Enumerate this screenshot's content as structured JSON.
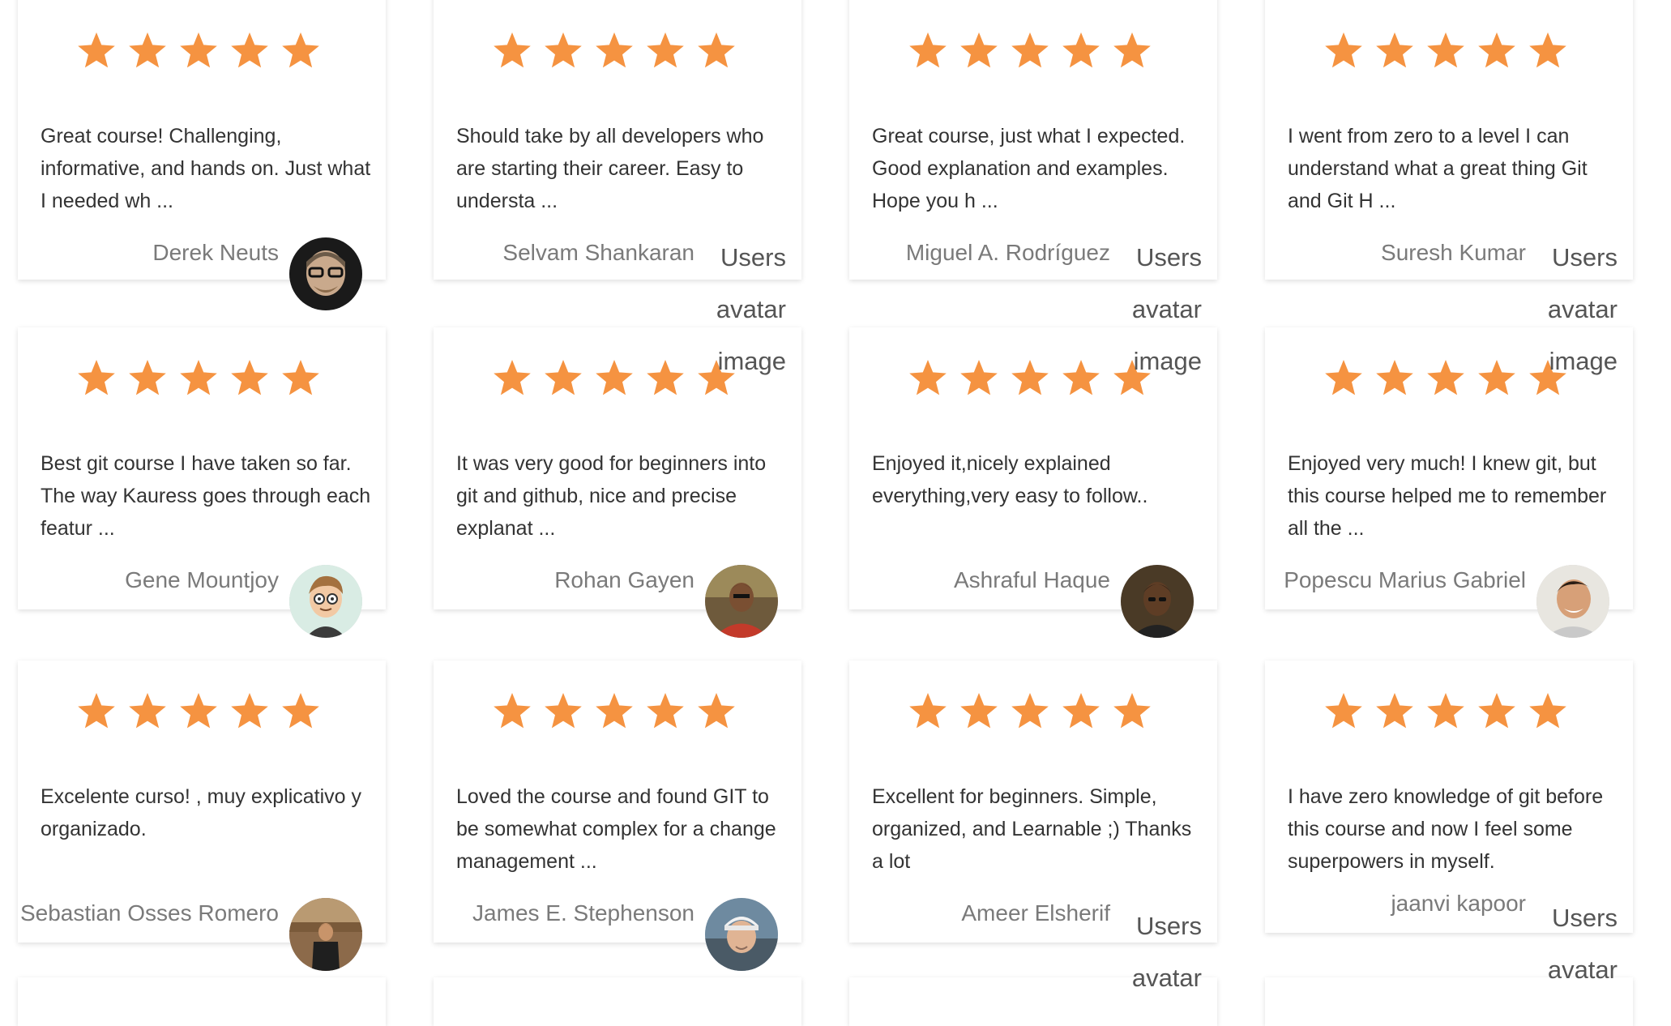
{
  "colors": {
    "star": "#f59341",
    "review_text": "#333333",
    "name_text": "#7a7a7a"
  },
  "rating_max": 5,
  "reviews": [
    {
      "rating": 5,
      "text": "Great course! Challenging, informative, and hands on. Just what I needed wh ...",
      "name": "Derek Neuts",
      "avatar": "photo"
    },
    {
      "rating": 5,
      "text": "Should take by all developers who are starting their career. Easy to understa ...",
      "name": "Selvam Shankaran",
      "avatar_alt": "Users avatar image"
    },
    {
      "rating": 5,
      "text": "Great course, just what I expected. Good explanation and examples. Hope you h ...",
      "name": "Miguel A. Rodríguez",
      "avatar_alt": "Users avatar image"
    },
    {
      "rating": 5,
      "text": "I went from zero to a level I can understand what a great thing Git and Git H ...",
      "name": "Suresh Kumar",
      "avatar_alt": "Users avatar image"
    },
    {
      "rating": 5,
      "text": "Best git course I have taken so far. The way Kauress goes through each featur ...",
      "name": "Gene Mountjoy",
      "avatar": "cartoon"
    },
    {
      "rating": 5,
      "text": "It was very good for beginners into git and github, nice and precise explanat ...",
      "name": "Rohan Gayen",
      "avatar": "photo"
    },
    {
      "rating": 5,
      "text": "Enjoyed it,nicely explained everything,very easy to follow..",
      "name": "Ashraful Haque",
      "avatar": "photo"
    },
    {
      "rating": 5,
      "text": "Enjoyed very much! I knew git, but this course helped me to remember all the ...",
      "name": "Popescu Marius Gabriel",
      "avatar": "photo"
    },
    {
      "rating": 5,
      "text": "Excelente curso! , muy explicativo y organizado.",
      "name": "Sebastian Osses Romero",
      "avatar": "photo"
    },
    {
      "rating": 5,
      "text": "Loved the course and found GIT to be somewhat complex for a change management ...",
      "name": "James E. Stephenson",
      "avatar": "photo"
    },
    {
      "rating": 5,
      "text": "Excellent for beginners. Simple, organized, and Learnable ;) Thanks a lot",
      "name": "Ameer Elsherif",
      "avatar_alt": "Users avatar"
    },
    {
      "rating": 5,
      "text": "I have zero knowledge of git before this course and now I feel some superpowers in myself.",
      "name": "jaanvi kapoor",
      "avatar_alt": "Users avatar"
    }
  ]
}
